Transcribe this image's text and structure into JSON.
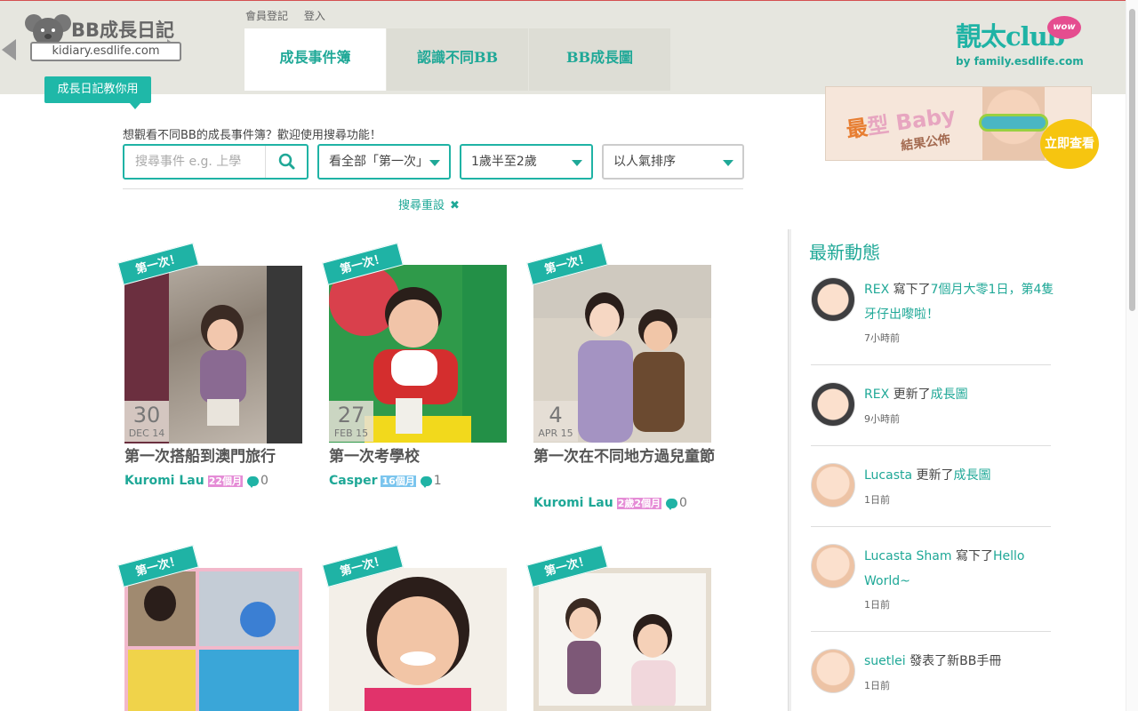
{
  "header": {
    "logo_title": "BB成長日記",
    "logo_url": "kidiary.esdlife.com",
    "guide_badge": "成長日記教你用",
    "member_links": [
      "會員登記",
      "登入"
    ],
    "tabs": [
      {
        "label": "成長事件簿",
        "active": true
      },
      {
        "label": "認識不同BB",
        "active": false
      },
      {
        "label": "BB成長圖",
        "active": false
      }
    ],
    "brand": {
      "name": "靚太club",
      "badge": "wow",
      "sub": "by family.esdlife.com"
    }
  },
  "promo": {
    "title_a": "最",
    "title_b": "型",
    "title_c": "Baby",
    "subtitle": "結果公佈",
    "button": "立即查看"
  },
  "search": {
    "hint": "想觀看不同BB的成長事件簿？歡迎使用搜尋功能！",
    "placeholder": "搜尋事件 e.g. 上學",
    "filter_event": "看全部「第一次」",
    "filter_age": "1歲半至2歲",
    "filter_sort": "以人氣排序",
    "reset": "搜尋重設"
  },
  "cards": [
    {
      "ribbon": "第一次！",
      "day": "30",
      "month": "DEC 14",
      "title": "第一次搭船到澳門旅行",
      "author": "Kuromi Lau",
      "age": "22個月",
      "age_color": "#e58cd6",
      "comments": "0"
    },
    {
      "ribbon": "第一次！",
      "day": "27",
      "month": "FEB 15",
      "title": "第一次考學校",
      "author": "Casper",
      "age": "16個月",
      "age_color": "#7bc5ee",
      "comments": "1"
    },
    {
      "ribbon": "第一次！",
      "day": "4",
      "month": "APR 15",
      "title": "第一次在不同地方過兒童節",
      "author": "Kuromi Lau",
      "age": "2歲2個月",
      "age_color": "#e58cd6",
      "comments": "0"
    },
    {
      "ribbon": "第一次！"
    },
    {
      "ribbon": "第一次！"
    },
    {
      "ribbon": "第一次！"
    }
  ],
  "feed": {
    "title": "最新動態",
    "items": [
      {
        "name": "REX",
        "action": "寫下了",
        "target": "7個月大零1日，第4隻牙仔出嚟啦！",
        "time": "7小時前"
      },
      {
        "name": "REX",
        "action": "更新了",
        "target": "成長圖",
        "time": "9小時前"
      },
      {
        "name": "Lucasta",
        "action": "更新了",
        "target": "成長圖",
        "time": "1日前"
      },
      {
        "name": "Lucasta Sham",
        "action": "寫下了",
        "target": "Hello World~",
        "time": "1日前"
      },
      {
        "name": "suetlei",
        "action": "發表了新BB手冊",
        "target": "",
        "time": "1日前"
      }
    ]
  },
  "colors": {
    "accent": "#1fb3a5",
    "header_bg": "#e6e6df",
    "promo_button": "#f6c510"
  }
}
